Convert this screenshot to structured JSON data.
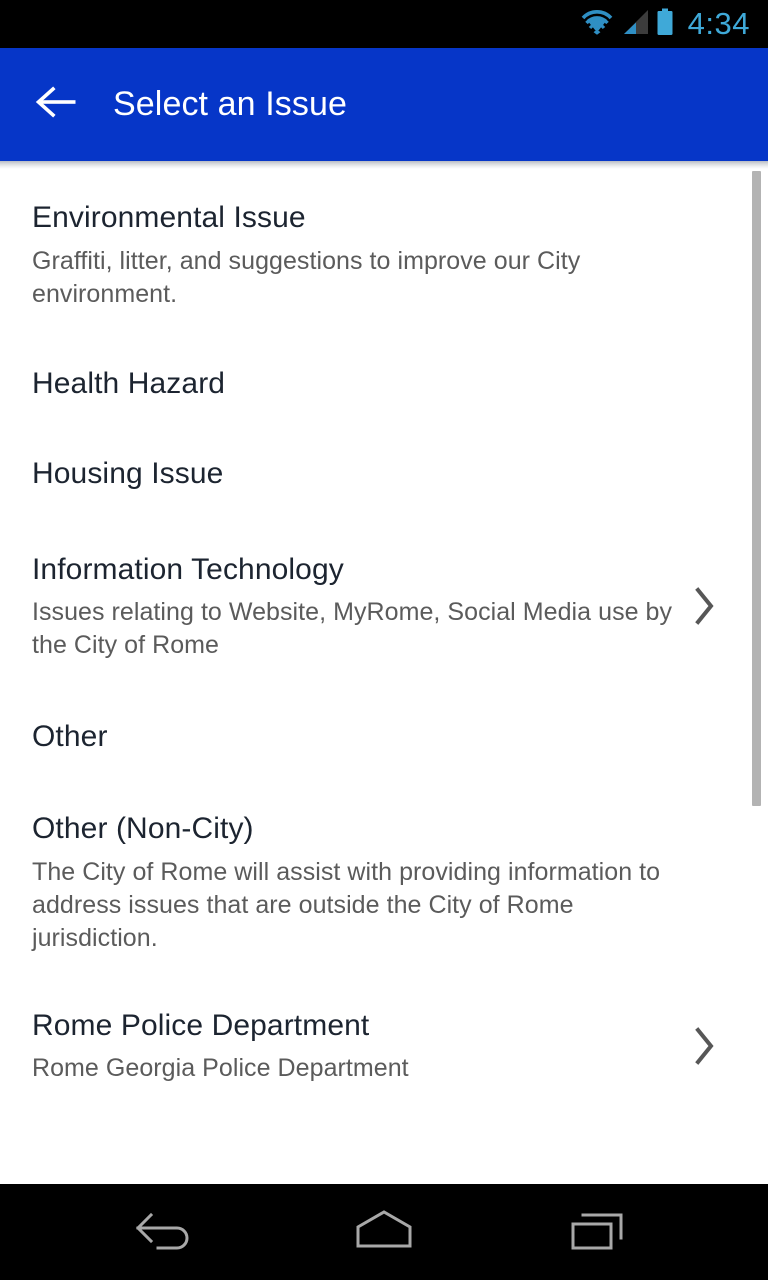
{
  "status_bar": {
    "time": "4:34",
    "icons": [
      "wifi-icon",
      "cell-signal-icon",
      "battery-icon"
    ],
    "accent_color": "#3fa9d8",
    "background": "#000000"
  },
  "app_bar": {
    "title": "Select an Issue",
    "back_icon": "arrow-left-icon",
    "background": "#0636c8",
    "text_color": "#ffffff"
  },
  "list": {
    "items": [
      {
        "title": "Environmental Issue",
        "subtitle": "Graffiti, litter, and suggestions to improve our City environment.",
        "chevron": false
      },
      {
        "title": "Health Hazard",
        "subtitle": "",
        "chevron": false
      },
      {
        "title": "Housing Issue",
        "subtitle": "",
        "chevron": false
      },
      {
        "title": "Information Technology",
        "subtitle": "Issues relating to Website, MyRome, Social Media use by the City of Rome",
        "chevron": true
      },
      {
        "title": "Other",
        "subtitle": "",
        "chevron": false
      },
      {
        "title": "Other (Non-City)",
        "subtitle": "The City of Rome will assist with providing information to address issues that are outside the City of Rome jurisdiction.",
        "chevron": false
      },
      {
        "title": "Rome Police Department",
        "subtitle": "Rome Georgia Police Department",
        "chevron": true
      }
    ],
    "title_color": "#1c2430",
    "subtitle_color": "#5b5b5b",
    "chevron_icon": "chevron-right-icon"
  },
  "scrollbar": {
    "thumb_color": "#b3b3b3"
  },
  "nav_bar": {
    "buttons": [
      "back-icon",
      "home-icon",
      "recents-icon"
    ],
    "background": "#000000",
    "icon_color": "#a8a8a8"
  }
}
